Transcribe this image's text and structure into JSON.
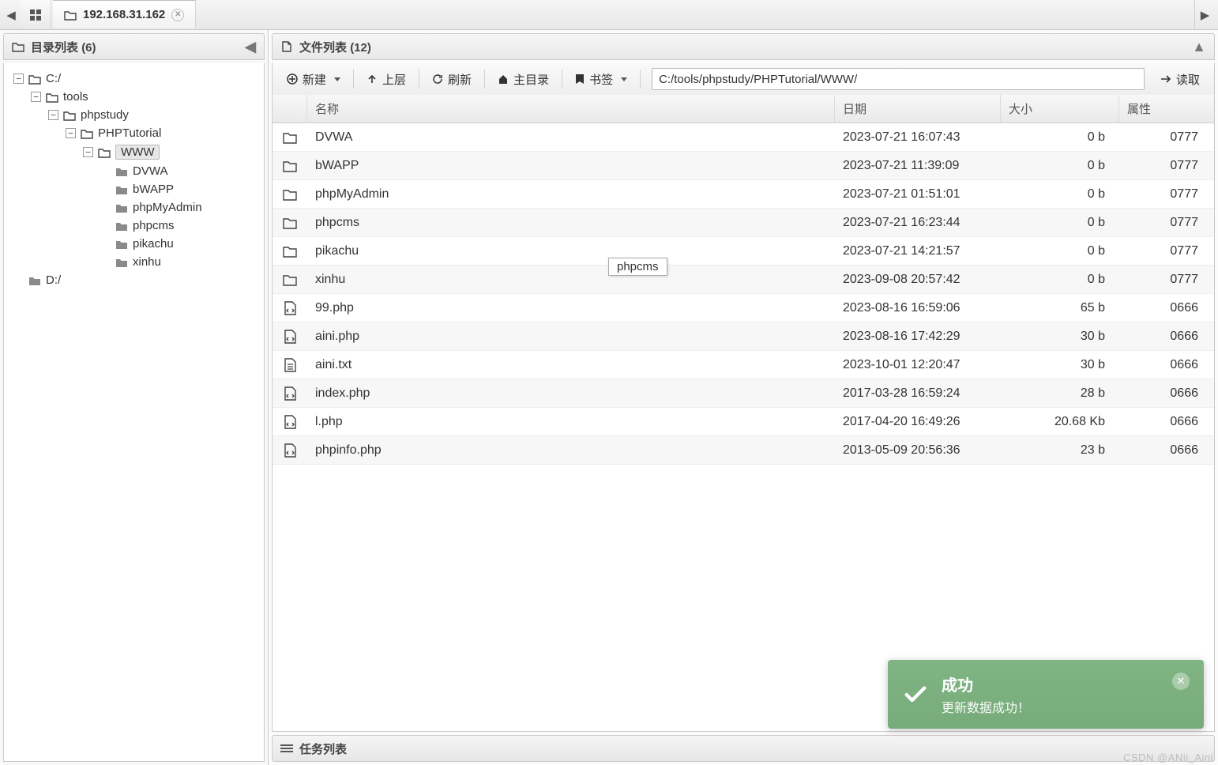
{
  "tabs": {
    "ip_tab": "192.168.31.162"
  },
  "left_panel": {
    "title_prefix": "目录列表",
    "count": "(6)"
  },
  "tree": {
    "c": "C:/",
    "tools": "tools",
    "phpstudy": "phpstudy",
    "phptutorial": "PHPTutorial",
    "www": "WWW",
    "dvwa": "DVWA",
    "bwapp": "bWAPP",
    "phpmyadmin": "phpMyAdmin",
    "phpcms": "phpcms",
    "pikachu": "pikachu",
    "xinhu": "xinhu",
    "d": "D:/"
  },
  "right_panel": {
    "title_prefix": "文件列表",
    "count": "(12)",
    "toolbar": {
      "new": "新建",
      "up": "上层",
      "refresh": "刷新",
      "home": "主目录",
      "bookmark": "书签",
      "read": "读取",
      "path": "C:/tools/phpstudy/PHPTutorial/WWW/"
    },
    "columns": {
      "name": "名称",
      "date": "日期",
      "size": "大小",
      "perm": "属性"
    },
    "rows": [
      {
        "icon": "folder",
        "name": "DVWA",
        "date": "2023-07-21 16:07:43",
        "size": "0 b",
        "perm": "0777"
      },
      {
        "icon": "folder",
        "name": "bWAPP",
        "date": "2023-07-21 11:39:09",
        "size": "0 b",
        "perm": "0777"
      },
      {
        "icon": "folder",
        "name": "phpMyAdmin",
        "date": "2023-07-21 01:51:01",
        "size": "0 b",
        "perm": "0777"
      },
      {
        "icon": "folder",
        "name": "phpcms",
        "date": "2023-07-21 16:23:44",
        "size": "0 b",
        "perm": "0777"
      },
      {
        "icon": "folder",
        "name": "pikachu",
        "date": "2023-07-21 14:21:57",
        "size": "0 b",
        "perm": "0777"
      },
      {
        "icon": "folder",
        "name": "xinhu",
        "date": "2023-09-08 20:57:42",
        "size": "0 b",
        "perm": "0777"
      },
      {
        "icon": "code",
        "name": "99.php",
        "date": "2023-08-16 16:59:06",
        "size": "65 b",
        "perm": "0666"
      },
      {
        "icon": "code",
        "name": "aini.php",
        "date": "2023-08-16 17:42:29",
        "size": "30 b",
        "perm": "0666"
      },
      {
        "icon": "text",
        "name": "aini.txt",
        "date": "2023-10-01 12:20:47",
        "size": "30 b",
        "perm": "0666"
      },
      {
        "icon": "code",
        "name": "index.php",
        "date": "2017-03-28 16:59:24",
        "size": "28 b",
        "perm": "0666"
      },
      {
        "icon": "code",
        "name": "l.php",
        "date": "2017-04-20 16:49:26",
        "size": "20.68 Kb",
        "perm": "0666"
      },
      {
        "icon": "code",
        "name": "phpinfo.php",
        "date": "2013-05-09 20:56:36",
        "size": "23 b",
        "perm": "0666"
      }
    ]
  },
  "tooltip_text": "phpcms",
  "task_list_title": "任务列表",
  "toast": {
    "title": "成功",
    "message": "更新数据成功！"
  },
  "watermark": "CSDN @ANii_Aini"
}
